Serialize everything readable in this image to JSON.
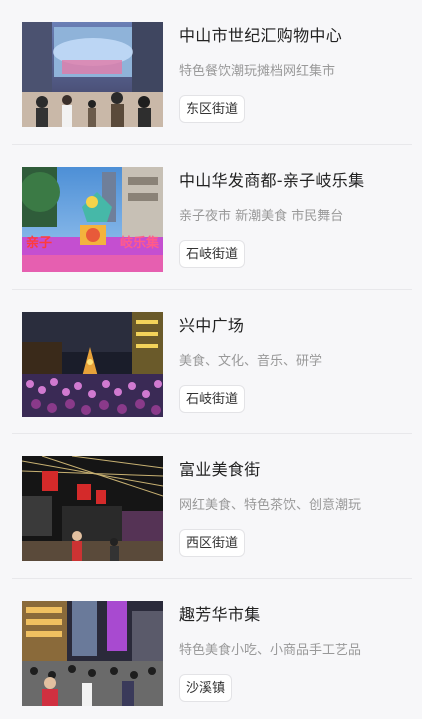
{
  "venues": [
    {
      "title": "中山市世纪汇购物中心",
      "desc": "特色餐饮潮玩摊档网红集市",
      "tag": "东区街道",
      "photo": "shopping-mall-night-market-photo"
    },
    {
      "title": "中山华发商都-亲子岐乐集",
      "desc": "亲子夜市 新潮美食 市民舞台",
      "tag": "石岐街道",
      "photo": "family-night-market-neon-sign-photo",
      "sign_text_left": "亲子",
      "sign_text_right": "岐乐集"
    },
    {
      "title": "兴中广场",
      "desc": "美食、文化、音乐、研学",
      "tag": "石岐街道",
      "photo": "plaza-crowd-christmas-tree-photo"
    },
    {
      "title": "富业美食街",
      "desc": "网红美食、特色茶饮、创意潮玩",
      "tag": "西区街道",
      "photo": "food-street-string-lights-photo"
    },
    {
      "title": "趣芳华市集",
      "desc": "特色美食小吃、小商品手工艺品",
      "tag": "沙溪镇",
      "photo": "street-market-crowd-photo"
    }
  ]
}
